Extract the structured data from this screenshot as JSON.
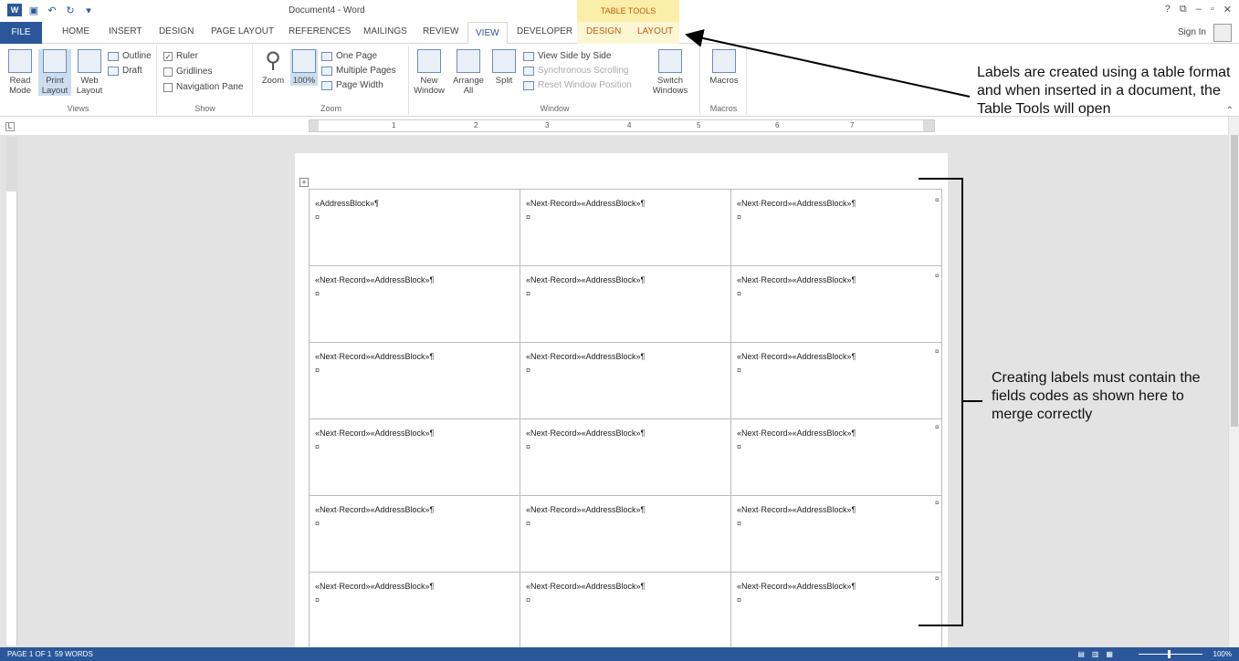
{
  "title_bar": {
    "document_title": "Document4 - Word",
    "contextual_title": "TABLE TOOLS",
    "window_controls": [
      "?",
      "⧉",
      "–",
      "▫",
      "✕"
    ]
  },
  "tabs": {
    "file": "FILE",
    "items": [
      "HOME",
      "INSERT",
      "DESIGN",
      "PAGE LAYOUT",
      "REFERENCES",
      "MAILINGS",
      "REVIEW",
      "VIEW",
      "DEVELOPER"
    ],
    "contextual": [
      "DESIGN",
      "LAYOUT"
    ],
    "active": "VIEW",
    "sign_in": "Sign In"
  },
  "ribbon": {
    "views": {
      "label": "Views",
      "read_mode": "Read Mode",
      "print_layout": "Print Layout",
      "web_layout": "Web Layout",
      "outline": "Outline",
      "draft": "Draft"
    },
    "show": {
      "label": "Show",
      "ruler": "Ruler",
      "gridlines": "Gridlines",
      "navigation_pane": "Navigation Pane",
      "ruler_checked": true
    },
    "zoom": {
      "label": "Zoom",
      "zoom": "Zoom",
      "hundred": "100%",
      "one_page": "One Page",
      "multiple_pages": "Multiple Pages",
      "page_width": "Page Width"
    },
    "window": {
      "label": "Window",
      "new_window": "New Window",
      "arrange_all": "Arrange All",
      "split": "Split",
      "view_side_by_side": "View Side by Side",
      "synchronous_scrolling": "Synchronous Scrolling",
      "reset_window_position": "Reset Window Position",
      "switch_windows": "Switch Windows"
    },
    "macros": {
      "label": "Macros",
      "macros": "Macros"
    }
  },
  "ruler_numbers": [
    "1",
    "2",
    "3",
    "4",
    "5",
    "6",
    "7"
  ],
  "document": {
    "first_cell": "«AddressBlock»¶",
    "other_cells": "«Next·Record»«AddressBlock»¶",
    "cell_end_mark": "¤",
    "rows": 6,
    "columns": 3
  },
  "status_bar": {
    "page": "PAGE 1 OF 1",
    "words": "59 WORDS",
    "zoom": "100%"
  },
  "callouts": {
    "table_tools": "Labels are created using a table format and when inserted in a document, the Table Tools will open",
    "fields": "Creating labels must contain the fields codes as shown here to merge correctly"
  },
  "colors": {
    "word_blue": "#2b579a",
    "context_tab": "#c55a11",
    "context_band": "#fbeea8"
  }
}
